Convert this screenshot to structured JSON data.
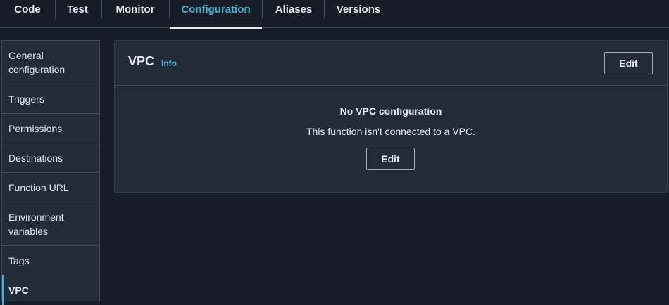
{
  "tabs": [
    {
      "label": "Code",
      "active": false
    },
    {
      "label": "Test",
      "active": false
    },
    {
      "label": "Monitor",
      "active": false
    },
    {
      "label": "Configuration",
      "active": true
    },
    {
      "label": "Aliases",
      "active": false
    },
    {
      "label": "Versions",
      "active": false
    }
  ],
  "sidebar": {
    "items": [
      {
        "label": "General configuration",
        "active": false
      },
      {
        "label": "Triggers",
        "active": false
      },
      {
        "label": "Permissions",
        "active": false
      },
      {
        "label": "Destinations",
        "active": false
      },
      {
        "label": "Function URL",
        "active": false
      },
      {
        "label": "Environment variables",
        "active": false
      },
      {
        "label": "Tags",
        "active": false
      },
      {
        "label": "VPC",
        "active": true
      }
    ]
  },
  "panel": {
    "title": "VPC",
    "info_label": "Info",
    "edit_label": "Edit",
    "empty_title": "No VPC configuration",
    "empty_description": "This function isn't connected to a VPC.",
    "empty_edit_label": "Edit"
  },
  "colors": {
    "background": "#161d26",
    "panel": "#232b37",
    "border": "#414d5c",
    "accent": "#42b4d6",
    "text": "#e6e9ee"
  }
}
